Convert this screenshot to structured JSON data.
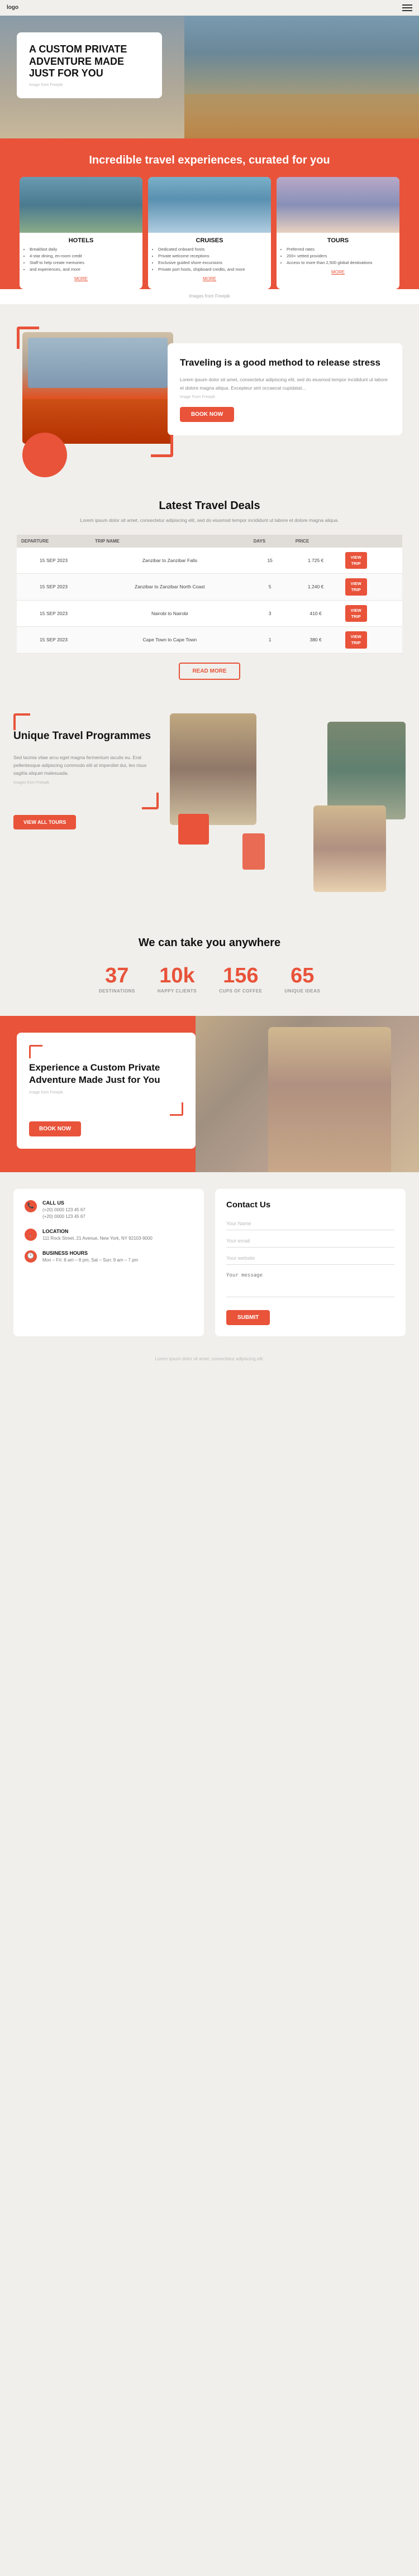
{
  "logo": "logo",
  "hero": {
    "title": "A CUSTOM PRIVATE ADVENTURE MADE JUST FOR YOU",
    "img_credit": "Image from Freepik"
  },
  "travel": {
    "heading": "Incredible travel experiences, curated for you",
    "cards": [
      {
        "id": "hotels",
        "title": "HOTELS",
        "features": [
          "Breakfast daily",
          "4-star dining, en-room credit",
          "Staff to help create memories",
          "and experiences, and more"
        ],
        "more": "MORE"
      },
      {
        "id": "cruises",
        "title": "CRUISES",
        "features": [
          "Dedicated onboard hosts",
          "Private welcome receptions",
          "Exclusive guided shore excursions",
          "Private port hosts, shipboard credits, and more"
        ],
        "more": "MORE"
      },
      {
        "id": "tours",
        "title": "TOURS",
        "features": [
          "Preferred rates",
          "200+ vetted providers",
          "Access to more than 2,500 global destinations"
        ],
        "more": "MORE"
      }
    ],
    "img_credit": "Images from Freepik"
  },
  "stress": {
    "heading": "Traveling is a good method to release stress",
    "body1": "Lorem ipsum dolor sit amet, consectetur adipiscing elit, sed do eiusmod tempor incididunt ut labore et dolore magna aliqua. Excepteur sint occaecat cupidatat...",
    "img_credit": "Image From Freepik",
    "btn": "BOOK NOW"
  },
  "deals": {
    "heading": "Latest Travel Deals",
    "intro": "Lorem ipsum dolor sit amet, consectetur adipiscing elit, sed do eiusmod tempor incididunt ut labore et dolore magna aliqua.",
    "columns": [
      "DEPARTURE",
      "TRIP NAME",
      "DAYS",
      "PRICE",
      ""
    ],
    "rows": [
      {
        "departure": "15 SEP 2023",
        "trip": "Zanzibar to Zanzibar Falls",
        "days": "15",
        "price": "1.725 €",
        "btn1": "VIEW",
        "btn2": "TRIP"
      },
      {
        "departure": "15 SEP 2023",
        "trip": "Zanzibar to Zanzibar North Coast",
        "days": "5",
        "price": "1.240 €",
        "btn1": "VIEW",
        "btn2": "TRIP"
      },
      {
        "departure": "15 SEP 2023",
        "trip": "Nairobi to Nairobi",
        "days": "3",
        "price": "410 €",
        "btn1": "VIEW",
        "btn2": "TRIP"
      },
      {
        "departure": "15 SEP 2023",
        "trip": "Cape Town to Cape Town",
        "days": "1",
        "price": "380 €",
        "btn1": "VIEW",
        "btn2": "TRIP"
      }
    ],
    "more_btn": "READ MORE"
  },
  "programmes": {
    "heading": "Unique Travel Programmes",
    "body": "Sed lacinia vitae arcu eget magna fermentum iaculis eu. Erat pellentesque adipiscing commodo elit at imperdiet dui, leo risus sagitta aliquet malesuada.",
    "img_credit": "Images from Freepik",
    "btn": "VIEW ALL TOURS"
  },
  "stats": {
    "heading": "We can take you anywhere",
    "items": [
      {
        "number": "37",
        "label": "DESTINATIONS"
      },
      {
        "number": "10k",
        "label": "HAPPY CLIENTS"
      },
      {
        "number": "156",
        "label": "CUPS OF COFFEE"
      },
      {
        "number": "65",
        "label": "UNIQUE IDEAS"
      }
    ]
  },
  "adventure": {
    "heading": "Experience a Custom Private Adventure Made Just for You",
    "img_credit": "Image from Freepik",
    "btn": "BOOK NOW"
  },
  "footer": {
    "contact_heading": "Contact Us",
    "call_label": "CALL US",
    "call_value": "(+20) 0000 123 45 67\n(+20) 0000 123 45 67",
    "location_label": "LOCATION",
    "location_value": "111 Rock Street, 21 Avenue, New York, NY 92103-9000",
    "hours_label": "BUSINESS HOURS",
    "hours_value": "Mon – Fri: 8 am – 8 pm, Sat – Sun: 9 am – 7 pm",
    "form": {
      "heading": "Contact Us",
      "name_placeholder": "Your Name",
      "email_placeholder": "Your email",
      "website_placeholder": "Your website",
      "message_placeholder": "Your message",
      "submit_btn": "SUBMIT"
    }
  },
  "footer_bottom": "Lorem ipsum dolor sit amet, consectetur adipiscing elit."
}
